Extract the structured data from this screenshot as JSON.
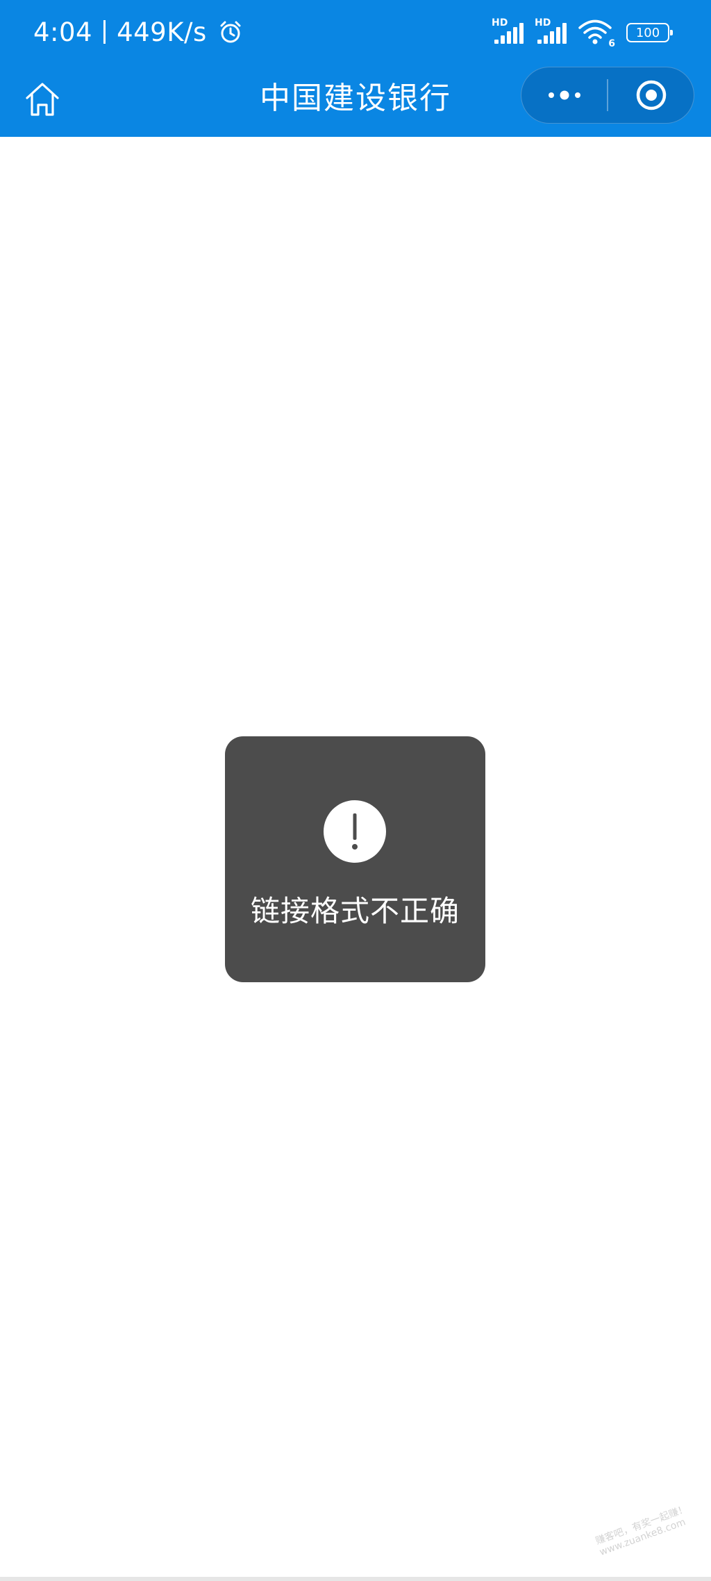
{
  "colors": {
    "brand": "#0a86e3",
    "toast_bg": "#4c4c4c",
    "white": "#ffffff"
  },
  "status_bar": {
    "time": "4:04",
    "speed": "449K/s",
    "alarm_icon": "alarm-clock-icon",
    "signal_1_label": "HD",
    "signal_2_label": "HD",
    "wifi_label": "6",
    "battery_level": "100"
  },
  "nav": {
    "home_icon": "home-icon",
    "title": "中国建设银行",
    "more_icon": "more-dots-icon",
    "close_icon": "target-close-icon"
  },
  "toast": {
    "icon": "exclamation-icon",
    "message": "链接格式不正确"
  },
  "watermark": {
    "line1": "赚客吧，有奖一起赚！",
    "line2": "www.zuanke8.com"
  }
}
